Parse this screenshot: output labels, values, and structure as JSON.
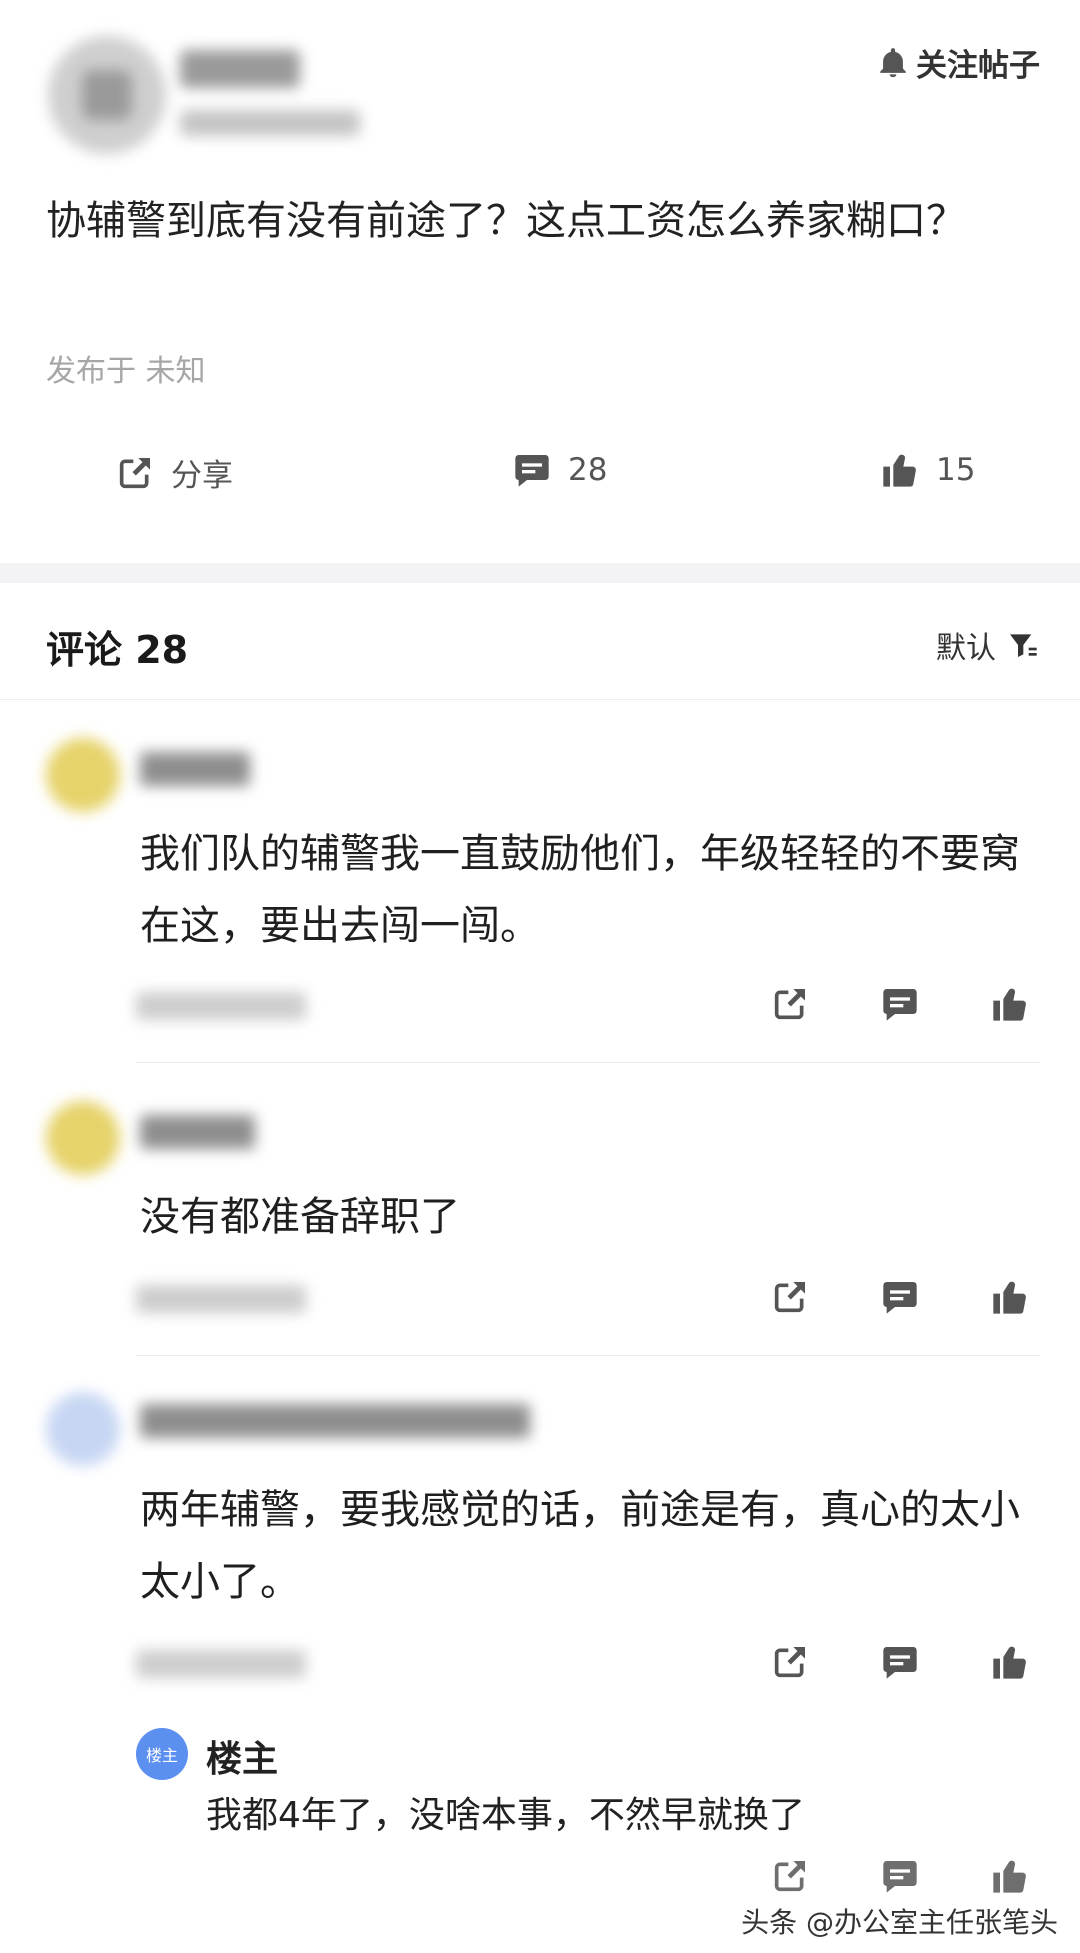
{
  "post": {
    "follow_label": "关注帖子",
    "title": "协辅警到底有没有前途了？这点工资怎么养家糊口？",
    "meta": "发布于 未知",
    "actions": {
      "share_label": "分享",
      "comment_count": "28",
      "like_count": "15"
    }
  },
  "comments_section": {
    "title": "评论 28",
    "sort_label": "默认"
  },
  "comments": [
    {
      "text": "我们队的辅警我一直鼓励他们，年级轻轻的不要窝在这，要出去闯一闯。"
    },
    {
      "text": "没有都准备辞职了"
    },
    {
      "text": "两年辅警，要我感觉的话，前途是有，真心的太小太小了。"
    }
  ],
  "reply": {
    "badge": "楼主",
    "name": "楼主",
    "text": "我都4年了，没啥本事，不然早就换了"
  },
  "watermark": "头条 @办公室主任张笔头"
}
